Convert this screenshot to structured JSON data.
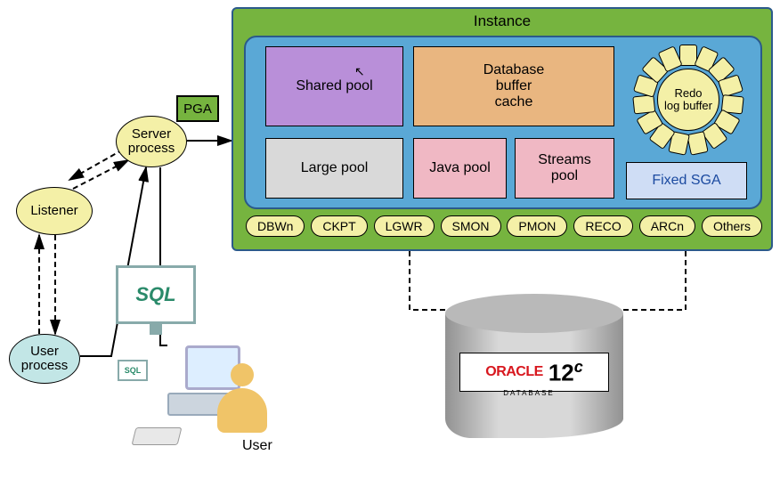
{
  "instance": {
    "title": "Instance",
    "sga": {
      "shared_pool": "Shared pool",
      "db_buffer_cache": "Database\nbuffer\ncache",
      "redo_log_buffer": "Redo\nlog buffer",
      "large_pool": "Large pool",
      "java_pool": "Java pool",
      "streams_pool": "Streams\npool",
      "fixed_sga": "Fixed SGA"
    },
    "processes": [
      "DBWn",
      "CKPT",
      "LGWR",
      "SMON",
      "PMON",
      "RECO",
      "ARCn",
      "Others"
    ]
  },
  "pga": "PGA",
  "server_process": "Server\nprocess",
  "listener": "Listener",
  "user_process": "User\nprocess",
  "user_label": "User",
  "sql_text": "SQL",
  "database": {
    "vendor": "ORACLE",
    "subtext": "DATABASE",
    "version": "12",
    "suffix": "c"
  }
}
